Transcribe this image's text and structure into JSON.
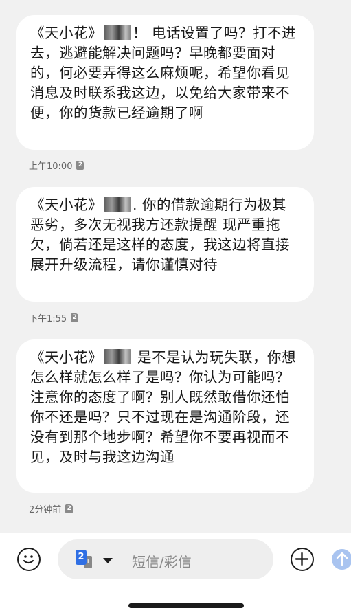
{
  "messages": [
    {
      "sender_open": "《天小花》",
      "body": "！ 电话设置了吗？打不进去，逃避能解决问题吗？早晚都要面对的，何必要弄得这么麻烦呢，希望你看见消息及时联系我这边，以免给大家带来不便，你的货款已经逾期了啊",
      "time": "上午10:00",
      "sim": "2"
    },
    {
      "sender_open": "《天小花》",
      "body": ". 你的借款逾期行为极其恶劣，多次无视我方还款提醒 现严重拖欠，倘若还是这样的态度，我这边将直接展开升级流程，请你谨慎对待",
      "time": "下午1:55",
      "sim": "2"
    },
    {
      "sender_open": "《天小花》",
      "body": " 是不是认为玩失联，你想怎么样就怎么样了是吗？你认为可能吗？注意你的态度了啊？别人既然敢借你还怕你不还是吗？只不过现在是沟通阶段，还没有到那个地步啊？希望你不要再视而不见，及时与我这边沟通",
      "time": "2分钟前",
      "sim": "2"
    }
  ],
  "composer": {
    "sim_slot": "2",
    "sim_slot_secondary": "1",
    "placeholder": "短信/彩信",
    "emoji_icon": "smiley-icon",
    "add_icon": "plus-circle-icon",
    "send_icon": "arrow-up-icon"
  },
  "colors": {
    "background": "#f1f1f1",
    "bubble": "#ffffff",
    "sim_badge": "#2f6fe4",
    "send_disabled": "#a9c4f0"
  }
}
